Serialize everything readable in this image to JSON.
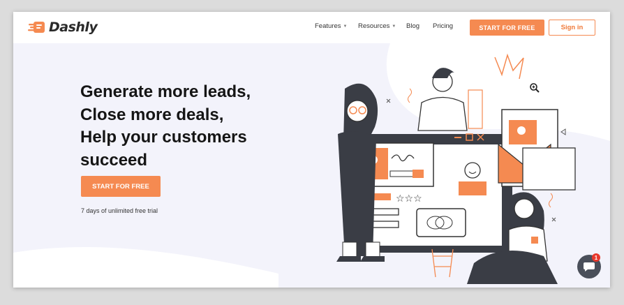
{
  "brand": {
    "name": "Dashly",
    "accent": "#f58a51",
    "dark": "#2a2a2a",
    "icon": "dashly-logo-icon"
  },
  "nav": {
    "items": [
      {
        "label": "Features",
        "has_dropdown": true
      },
      {
        "label": "Resources",
        "has_dropdown": true
      },
      {
        "label": "Blog",
        "has_dropdown": false
      },
      {
        "label": "Pricing",
        "has_dropdown": false
      }
    ],
    "cta_label": "START FOR FREE",
    "signin_label": "Sign in"
  },
  "hero": {
    "lines": [
      "Generate more leads,",
      "Close more deals,",
      "Help your customers",
      "succeed"
    ],
    "cta_label": "START FOR FREE",
    "trial_text": "7 days of unlimited free trial"
  },
  "chat": {
    "icon": "chat-icon",
    "badge_count": "1"
  },
  "icons": [
    "chevron-down-icon",
    "zoom-in-icon",
    "chat-icon"
  ]
}
